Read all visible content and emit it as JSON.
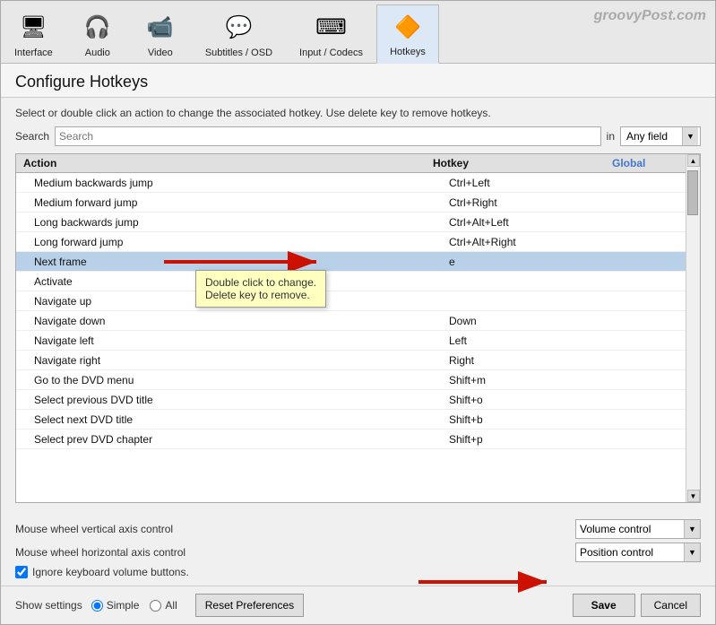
{
  "watermark": "groovyPost.com",
  "tabs": [
    {
      "id": "interface",
      "label": "Interface",
      "icon": "🖥",
      "active": false
    },
    {
      "id": "audio",
      "label": "Audio",
      "icon": "🎧",
      "active": false
    },
    {
      "id": "video",
      "label": "Video",
      "icon": "📹",
      "active": false
    },
    {
      "id": "subtitles",
      "label": "Subtitles / OSD",
      "icon": "💬",
      "active": false
    },
    {
      "id": "input",
      "label": "Input / Codecs",
      "icon": "⌨",
      "active": false
    },
    {
      "id": "hotkeys",
      "label": "Hotkeys",
      "icon": "🔶",
      "active": true
    }
  ],
  "page_title": "Configure Hotkeys",
  "description": "Select or double click an action to change the associated hotkey. Use delete key to remove hotkeys.",
  "search": {
    "label": "Search",
    "placeholder": "Search",
    "in_label": "in",
    "field_label": "Any field"
  },
  "table": {
    "headers": {
      "action": "Action",
      "hotkey": "Hotkey",
      "global": "Global"
    },
    "rows": [
      {
        "action": "Medium backwards jump",
        "hotkey": "Ctrl+Left",
        "global": ""
      },
      {
        "action": "Medium forward jump",
        "hotkey": "Ctrl+Right",
        "global": ""
      },
      {
        "action": "Long backwards jump",
        "hotkey": "Ctrl+Alt+Left",
        "global": ""
      },
      {
        "action": "Long forward jump",
        "hotkey": "Ctrl+Alt+Right",
        "global": ""
      },
      {
        "action": "Next frame",
        "hotkey": "e",
        "global": "",
        "selected": true
      },
      {
        "action": "Activate",
        "hotkey": "",
        "global": ""
      },
      {
        "action": "Navigate up",
        "hotkey": "",
        "global": ""
      },
      {
        "action": "Navigate down",
        "hotkey": "Down",
        "global": ""
      },
      {
        "action": "Navigate left",
        "hotkey": "Left",
        "global": ""
      },
      {
        "action": "Navigate right",
        "hotkey": "Right",
        "global": ""
      },
      {
        "action": "Go to the DVD menu",
        "hotkey": "Shift+m",
        "global": ""
      },
      {
        "action": "Select previous DVD title",
        "hotkey": "Shift+o",
        "global": ""
      },
      {
        "action": "Select next DVD title",
        "hotkey": "Shift+b",
        "global": ""
      },
      {
        "action": "Select prev DVD chapter",
        "hotkey": "Shift+p",
        "global": ""
      }
    ]
  },
  "tooltip": {
    "line1": "Double click to change.",
    "line2": "Delete key to remove."
  },
  "mouse_controls": [
    {
      "label": "Mouse wheel vertical axis control",
      "value": "Volume control"
    },
    {
      "label": "Mouse wheel horizontal axis control",
      "value": "Position control"
    }
  ],
  "checkbox": {
    "label": "Ignore keyboard volume buttons.",
    "checked": true
  },
  "show_settings": {
    "label": "Show settings",
    "options": [
      "Simple",
      "All"
    ],
    "selected": "Simple"
  },
  "buttons": {
    "reset": "Reset Preferences",
    "save": "Save",
    "cancel": "Cancel"
  }
}
